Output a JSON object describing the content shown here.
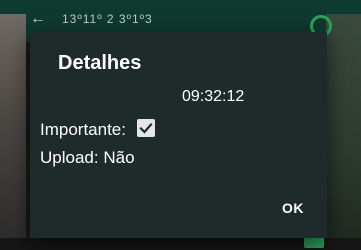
{
  "background": {
    "title_text": "13º11º 2 3º1º3"
  },
  "dialog": {
    "title": "Detalhes",
    "time": "09:32:12",
    "important_label": "Importante:",
    "important_checked": true,
    "upload_label": "Upload:",
    "upload_value": "Não",
    "ok_label": "OK"
  },
  "colors": {
    "dialog_bg": "#1f2a2a",
    "accent_green": "#2aa35a"
  }
}
